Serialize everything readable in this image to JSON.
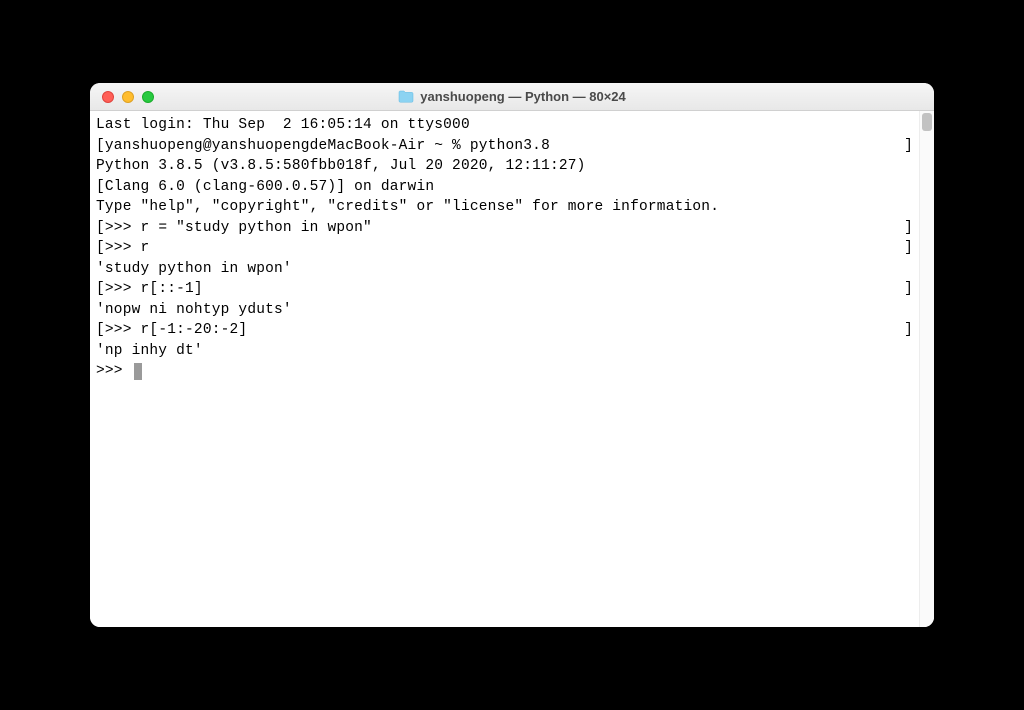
{
  "window": {
    "title": "yanshuopeng — Python — 80×24"
  },
  "terminal": {
    "lines": [
      "Last login: Thu Sep  2 16:05:14 on ttys000",
      "yanshuopeng@yanshuopengdeMacBook-Air ~ % python3.8",
      "Python 3.8.5 (v3.8.5:580fbb018f, Jul 20 2020, 12:11:27) ",
      "[Clang 6.0 (clang-600.0.57)] on darwin",
      "Type \"help\", \"copyright\", \"credits\" or \"license\" for more information.",
      ">>> r = \"study python in wpon\"",
      ">>> r",
      "'study python in wpon'",
      ">>> r[::-1]",
      "'nopw ni nohtyp yduts'",
      ">>> r[-1:-20:-2]",
      "'np inhy dt'",
      ">>> "
    ],
    "bracketed": [
      false,
      true,
      false,
      false,
      false,
      true,
      true,
      false,
      true,
      false,
      true,
      false,
      false
    ]
  }
}
